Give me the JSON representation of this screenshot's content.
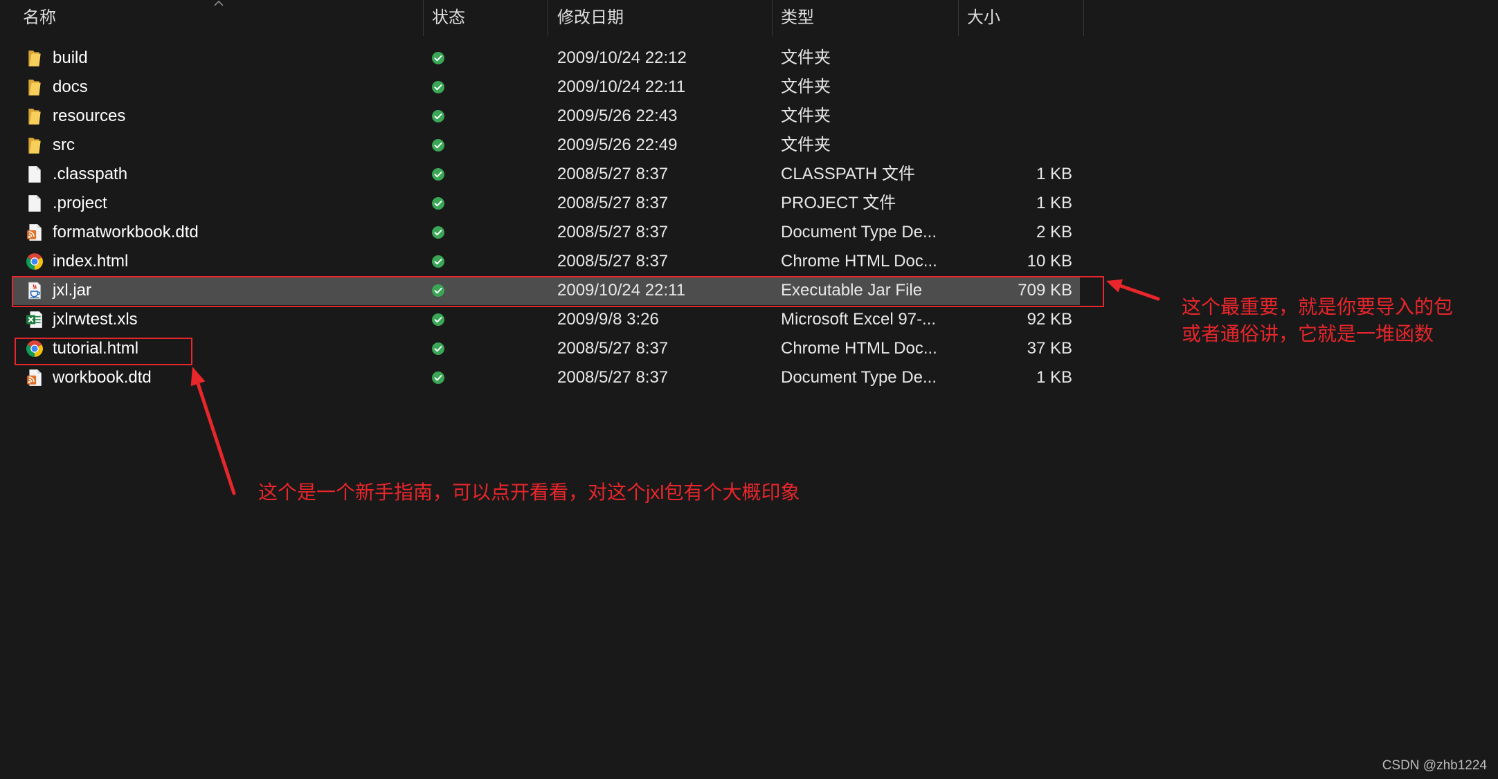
{
  "header": {
    "sort_indicator": "chevron-up-icon",
    "columns": {
      "name": "名称",
      "status": "状态",
      "modified": "修改日期",
      "type": "类型",
      "size": "大小"
    }
  },
  "files": [
    {
      "name": "build",
      "icon": "folder-icon",
      "status": "sync-available-icon",
      "modified": "2009/10/24 22:12",
      "type": "文件夹"
    },
    {
      "name": "docs",
      "icon": "folder-icon",
      "status": "sync-available-icon",
      "modified": "2009/10/24 22:11",
      "type": "文件夹"
    },
    {
      "name": "resources",
      "icon": "folder-icon",
      "status": "sync-available-icon",
      "modified": "2009/5/26 22:43",
      "type": "文件夹"
    },
    {
      "name": "src",
      "icon": "folder-icon",
      "status": "sync-available-icon",
      "modified": "2009/5/26 22:49",
      "type": "文件夹"
    },
    {
      "name": ".classpath",
      "icon": "file-icon",
      "status": "sync-available-icon",
      "modified": "2008/5/27 8:37",
      "type": "CLASSPATH 文件",
      "size": "1 KB"
    },
    {
      "name": ".project",
      "icon": "file-icon",
      "status": "sync-available-icon",
      "modified": "2008/5/27 8:37",
      "type": "PROJECT 文件",
      "size": "1 KB"
    },
    {
      "name": "formatworkbook.dtd",
      "icon": "dtd-file-icon",
      "status": "sync-available-icon",
      "modified": "2008/5/27 8:37",
      "type": "Document Type De...",
      "size": "2 KB"
    },
    {
      "name": "index.html",
      "icon": "chrome-html-icon",
      "status": "sync-available-icon",
      "modified": "2008/5/27 8:37",
      "type": "Chrome HTML Doc...",
      "size": "10 KB"
    },
    {
      "name": "jxl.jar",
      "icon": "java-jar-icon",
      "status": "sync-available-icon",
      "modified": "2009/10/24 22:11",
      "type": "Executable Jar File",
      "size": "709 KB",
      "selected": true
    },
    {
      "name": "jxlrwtest.xls",
      "icon": "excel-icon",
      "status": "sync-available-icon",
      "modified": "2009/9/8 3:26",
      "type": "Microsoft Excel 97-...",
      "size": "92 KB"
    },
    {
      "name": "tutorial.html",
      "icon": "chrome-html-icon",
      "status": "sync-available-icon",
      "modified": "2008/5/27 8:37",
      "type": "Chrome HTML Doc...",
      "size": "37 KB"
    },
    {
      "name": "workbook.dtd",
      "icon": "dtd-file-icon",
      "status": "sync-available-icon",
      "modified": "2008/5/27 8:37",
      "type": "Document Type De...",
      "size": "1 KB"
    }
  ],
  "annotations": {
    "jar_note": [
      "这个最重要，就是你要导入的包",
      "或者通俗讲，它就是一堆函数"
    ],
    "tutorial_note": "这个是一个新手指南，可以点开看看，对这个jxl包有个大概印象"
  },
  "watermark": "CSDN @zhb1224",
  "colors": {
    "background": "#191919",
    "selection": "#4d4d4d",
    "annotation": "#e8262b",
    "status_ok": "#3aa757",
    "folder": "#f8cf5a"
  }
}
